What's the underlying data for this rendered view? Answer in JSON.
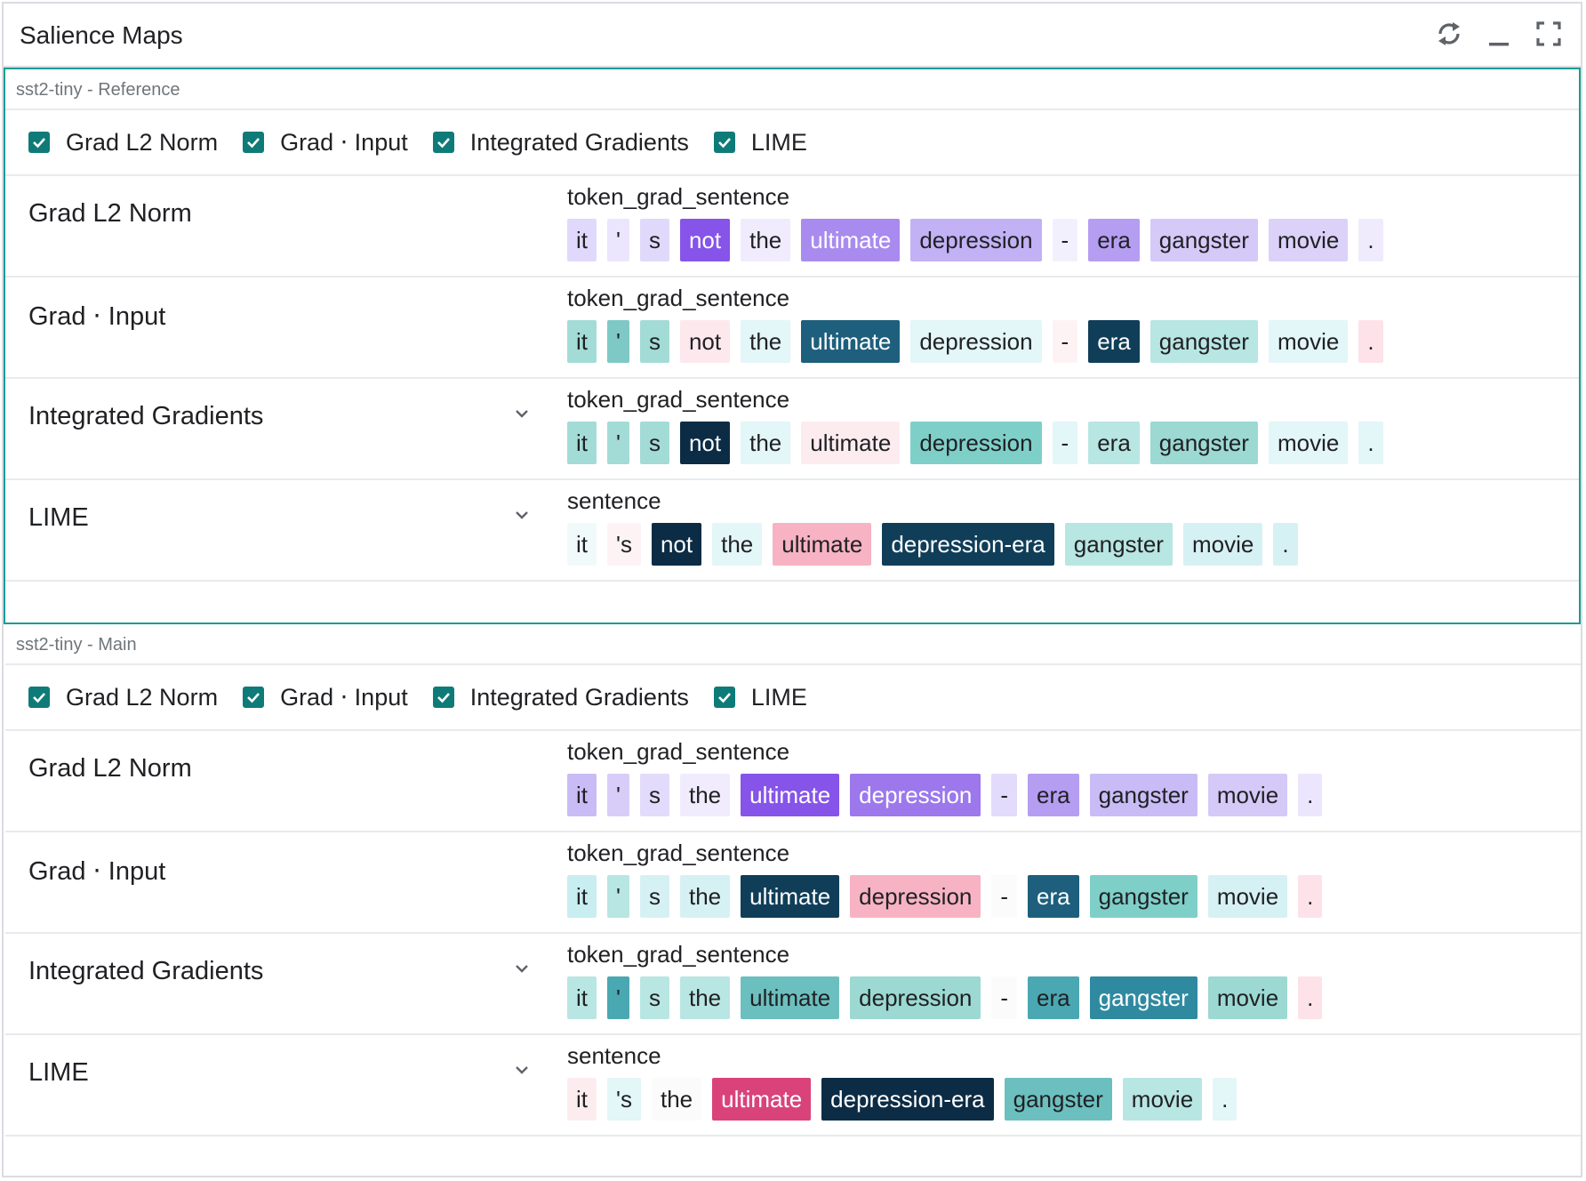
{
  "header": {
    "title": "Salience Maps",
    "icons": [
      "refresh-icon",
      "minimize-icon",
      "fullscreen-icon"
    ]
  },
  "groups": [
    {
      "label": "sst2-tiny - Reference",
      "checkboxes": [
        "Grad L2 Norm",
        "Grad ⋅ Input",
        "Integrated Gradients",
        "LIME"
      ],
      "rows": [
        {
          "name": "Grad L2 Norm",
          "field": "token_grad_sentence",
          "dropdown": false,
          "tokens": [
            {
              "t": "it",
              "bg": "#e0d9fb",
              "fg": "#202124"
            },
            {
              "t": "'",
              "bg": "#ebe6fd",
              "fg": "#202124"
            },
            {
              "t": "s",
              "bg": "#e0d9fb",
              "fg": "#202124"
            },
            {
              "t": "not",
              "bg": "#8654e8",
              "fg": "#ffffff"
            },
            {
              "t": "the",
              "bg": "#f0ecfd",
              "fg": "#202124"
            },
            {
              "t": "ultimate",
              "bg": "#a98bef",
              "fg": "#ffffff"
            },
            {
              "t": "depression",
              "bg": "#c2b1f4",
              "fg": "#202124"
            },
            {
              "t": "-",
              "bg": "#f3f0fe",
              "fg": "#202124"
            },
            {
              "t": "era",
              "bg": "#b59df2",
              "fg": "#202124"
            },
            {
              "t": "gangster",
              "bg": "#d5c9f8",
              "fg": "#202124"
            },
            {
              "t": "movie",
              "bg": "#dbd1f9",
              "fg": "#202124"
            },
            {
              "t": ".",
              "bg": "#efebfd",
              "fg": "#202124"
            }
          ]
        },
        {
          "name": "Grad ⋅ Input",
          "field": "token_grad_sentence",
          "dropdown": false,
          "tokens": [
            {
              "t": "it",
              "bg": "#a3dcd6",
              "fg": "#202124"
            },
            {
              "t": "'",
              "bg": "#7ec9c6",
              "fg": "#202124"
            },
            {
              "t": "s",
              "bg": "#a3dcd6",
              "fg": "#202124"
            },
            {
              "t": "not",
              "bg": "#fde8ee",
              "fg": "#202124"
            },
            {
              "t": "the",
              "bg": "#e3f6f8",
              "fg": "#202124"
            },
            {
              "t": "ultimate",
              "bg": "#1d5f7c",
              "fg": "#ffffff"
            },
            {
              "t": "depression",
              "bg": "#e3f6f8",
              "fg": "#202124"
            },
            {
              "t": "-",
              "bg": "#fdf3f5",
              "fg": "#202124"
            },
            {
              "t": "era",
              "bg": "#103e59",
              "fg": "#ffffff"
            },
            {
              "t": "gangster",
              "bg": "#b8e6e2",
              "fg": "#202124"
            },
            {
              "t": "movie",
              "bg": "#e3f6f8",
              "fg": "#202124"
            },
            {
              "t": ".",
              "bg": "#fde2e9",
              "fg": "#202124"
            }
          ]
        },
        {
          "name": "Integrated Gradients",
          "field": "token_grad_sentence",
          "dropdown": true,
          "tokens": [
            {
              "t": "it",
              "bg": "#a3dcd6",
              "fg": "#202124"
            },
            {
              "t": "'",
              "bg": "#a3dcd6",
              "fg": "#202124"
            },
            {
              "t": "s",
              "bg": "#a3dcd6",
              "fg": "#202124"
            },
            {
              "t": "not",
              "bg": "#0c2c45",
              "fg": "#ffffff"
            },
            {
              "t": "the",
              "bg": "#e3f6f8",
              "fg": "#202124"
            },
            {
              "t": "ultimate",
              "bg": "#fdecef",
              "fg": "#202124"
            },
            {
              "t": "depression",
              "bg": "#7fcfc9",
              "fg": "#202124"
            },
            {
              "t": "-",
              "bg": "#e3f6f8",
              "fg": "#202124"
            },
            {
              "t": "era",
              "bg": "#b8e6e2",
              "fg": "#202124"
            },
            {
              "t": "gangster",
              "bg": "#9bd9d2",
              "fg": "#202124"
            },
            {
              "t": "movie",
              "bg": "#e3f6f8",
              "fg": "#202124"
            },
            {
              "t": ".",
              "bg": "#e3f6f8",
              "fg": "#202124"
            }
          ]
        },
        {
          "name": "LIME",
          "field": "sentence",
          "dropdown": true,
          "tokens": [
            {
              "t": "it",
              "bg": "#f1fafb",
              "fg": "#202124"
            },
            {
              "t": "'s",
              "bg": "#fdf3f5",
              "fg": "#202124"
            },
            {
              "t": "not",
              "bg": "#0c2c45",
              "fg": "#ffffff"
            },
            {
              "t": "the",
              "bg": "#e3f6f8",
              "fg": "#202124"
            },
            {
              "t": "ultimate",
              "bg": "#f7b3c3",
              "fg": "#202124"
            },
            {
              "t": "depression-era",
              "bg": "#103e59",
              "fg": "#ffffff"
            },
            {
              "t": "gangster",
              "bg": "#b8e6e2",
              "fg": "#202124"
            },
            {
              "t": "movie",
              "bg": "#d6f1f4",
              "fg": "#202124"
            },
            {
              "t": ".",
              "bg": "#d6f1f4",
              "fg": "#202124"
            }
          ]
        }
      ]
    },
    {
      "label": "sst2-tiny - Main",
      "checkboxes": [
        "Grad L2 Norm",
        "Grad ⋅ Input",
        "Integrated Gradients",
        "LIME"
      ],
      "rows": [
        {
          "name": "Grad L2 Norm",
          "field": "token_grad_sentence",
          "dropdown": false,
          "tokens": [
            {
              "t": "it",
              "bg": "#c9bcf6",
              "fg": "#202124"
            },
            {
              "t": "'",
              "bg": "#d8cdf9",
              "fg": "#202124"
            },
            {
              "t": "s",
              "bg": "#e3dbfb",
              "fg": "#202124"
            },
            {
              "t": "the",
              "bg": "#f0ecfd",
              "fg": "#202124"
            },
            {
              "t": "ultimate",
              "bg": "#8654e8",
              "fg": "#ffffff"
            },
            {
              "t": "depression",
              "bg": "#9c78ec",
              "fg": "#ffffff"
            },
            {
              "t": "-",
              "bg": "#e3dbfb",
              "fg": "#202124"
            },
            {
              "t": "era",
              "bg": "#b59df2",
              "fg": "#202124"
            },
            {
              "t": "gangster",
              "bg": "#c9bcf6",
              "fg": "#202124"
            },
            {
              "t": "movie",
              "bg": "#d5c9f8",
              "fg": "#202124"
            },
            {
              "t": ".",
              "bg": "#ebe6fd",
              "fg": "#202124"
            }
          ]
        },
        {
          "name": "Grad ⋅ Input",
          "field": "token_grad_sentence",
          "dropdown": false,
          "tokens": [
            {
              "t": "it",
              "bg": "#c8eef1",
              "fg": "#202124"
            },
            {
              "t": "'",
              "bg": "#b8e6e2",
              "fg": "#202124"
            },
            {
              "t": "s",
              "bg": "#d6f1f4",
              "fg": "#202124"
            },
            {
              "t": "the",
              "bg": "#d6f1f4",
              "fg": "#202124"
            },
            {
              "t": "ultimate",
              "bg": "#103e59",
              "fg": "#ffffff"
            },
            {
              "t": "depression",
              "bg": "#f7b3c3",
              "fg": "#202124"
            },
            {
              "t": "-",
              "bg": "#fbfbfb",
              "fg": "#202124"
            },
            {
              "t": "era",
              "bg": "#1d5f7c",
              "fg": "#ffffff"
            },
            {
              "t": "gangster",
              "bg": "#7fcfc9",
              "fg": "#202124"
            },
            {
              "t": "movie",
              "bg": "#d6f1f4",
              "fg": "#202124"
            },
            {
              "t": ".",
              "bg": "#fde2e9",
              "fg": "#202124"
            }
          ]
        },
        {
          "name": "Integrated Gradients",
          "field": "token_grad_sentence",
          "dropdown": true,
          "tokens": [
            {
              "t": "it",
              "bg": "#b8e6e2",
              "fg": "#202124"
            },
            {
              "t": "'",
              "bg": "#4aa8b2",
              "fg": "#202124"
            },
            {
              "t": "s",
              "bg": "#b8e6e2",
              "fg": "#202124"
            },
            {
              "t": "the",
              "bg": "#b8e6e2",
              "fg": "#202124"
            },
            {
              "t": "ultimate",
              "bg": "#6cbfbf",
              "fg": "#202124"
            },
            {
              "t": "depression",
              "bg": "#9bd9d2",
              "fg": "#202124"
            },
            {
              "t": "-",
              "bg": "#fbfbfb",
              "fg": "#202124"
            },
            {
              "t": "era",
              "bg": "#4aa8b2",
              "fg": "#202124"
            },
            {
              "t": "gangster",
              "bg": "#2f8aa0",
              "fg": "#ffffff"
            },
            {
              "t": "movie",
              "bg": "#9bd9d2",
              "fg": "#202124"
            },
            {
              "t": ".",
              "bg": "#fde2e9",
              "fg": "#202124"
            }
          ]
        },
        {
          "name": "LIME",
          "field": "sentence",
          "dropdown": true,
          "tokens": [
            {
              "t": "it",
              "bg": "#fdecef",
              "fg": "#202124"
            },
            {
              "t": "'s",
              "bg": "#e3f6f8",
              "fg": "#202124"
            },
            {
              "t": "the",
              "bg": "#fbfbfb",
              "fg": "#202124"
            },
            {
              "t": "ultimate",
              "bg": "#d9437a",
              "fg": "#ffffff"
            },
            {
              "t": "depression-era",
              "bg": "#0c2c45",
              "fg": "#ffffff"
            },
            {
              "t": "gangster",
              "bg": "#6cbfbf",
              "fg": "#202124"
            },
            {
              "t": "movie",
              "bg": "#b8e6e2",
              "fg": "#202124"
            },
            {
              "t": ".",
              "bg": "#e3f6f8",
              "fg": "#202124"
            }
          ]
        }
      ]
    }
  ]
}
